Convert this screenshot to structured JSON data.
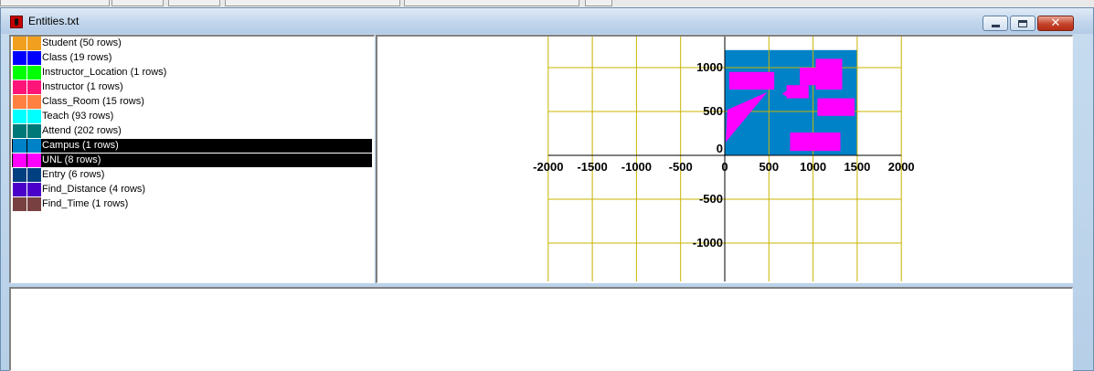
{
  "window": {
    "title": "Entities.txt"
  },
  "colors": {
    "map_background": "#0082c8",
    "shape_fill": "#ff00ff",
    "grid_line": "#c8b400",
    "selection_background": "#000000"
  },
  "entities": [
    {
      "label": "Student (50 rows)",
      "color": "#f0a01e",
      "selected": false
    },
    {
      "label": "Class (19 rows)",
      "color": "#0000ff",
      "selected": false
    },
    {
      "label": "Instructor_Location (1 rows)",
      "color": "#00ff00",
      "selected": false
    },
    {
      "label": "Instructor (1 rows)",
      "color": "#ff1478",
      "selected": false
    },
    {
      "label": "Class_Room (15 rows)",
      "color": "#ff8040",
      "selected": false
    },
    {
      "label": "Teach (93 rows)",
      "color": "#00ffff",
      "selected": false
    },
    {
      "label": "Attend (202 rows)",
      "color": "#007878",
      "selected": false
    },
    {
      "label": "Campus (1 rows)",
      "color": "#0082c8",
      "selected": true
    },
    {
      "label": "UNL (8 rows)",
      "color": "#ff00ff",
      "selected": true
    },
    {
      "label": "Entry (6 rows)",
      "color": "#004080",
      "selected": false
    },
    {
      "label": "Find_Distance (4 rows)",
      "color": "#4a00c8",
      "selected": false
    },
    {
      "label": "Find_Time (1 rows)",
      "color": "#784040",
      "selected": false
    }
  ],
  "map": {
    "x_ticks": [
      "-2000",
      "-1500",
      "-1000",
      "-500",
      "0",
      "500",
      "1000",
      "1500",
      "2000"
    ],
    "y_ticks": [
      "1000",
      "500",
      "0",
      "-500",
      "-1000"
    ],
    "grid": true
  }
}
